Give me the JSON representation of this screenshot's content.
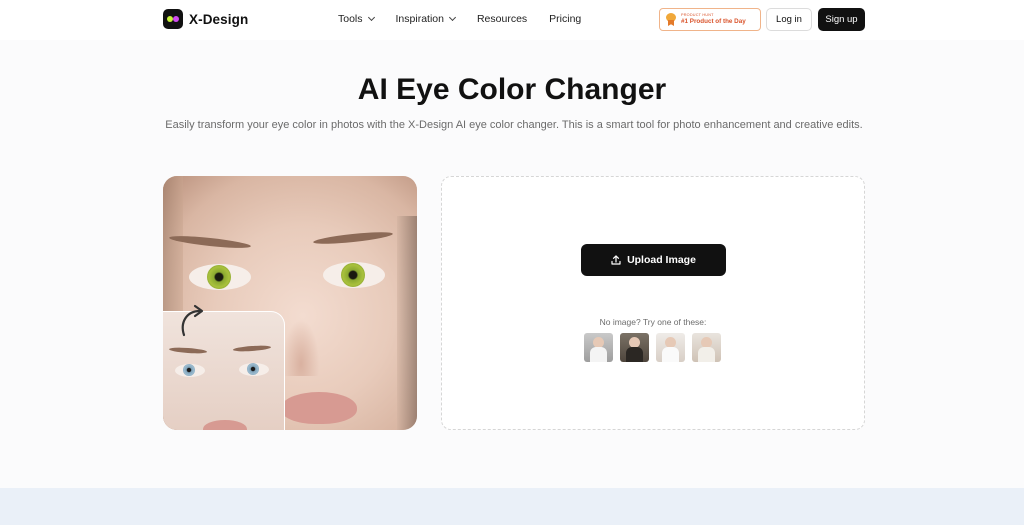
{
  "header": {
    "logo_text": "X-Design",
    "nav": [
      {
        "label": "Tools",
        "has_dropdown": true
      },
      {
        "label": "Inspiration",
        "has_dropdown": true
      },
      {
        "label": "Resources",
        "has_dropdown": false
      },
      {
        "label": "Pricing",
        "has_dropdown": false
      }
    ],
    "badge": {
      "small_text": "PRODUCT HUNT",
      "main_text": "#1 Product of the Day"
    },
    "login_label": "Log in",
    "signup_label": "Sign up"
  },
  "hero": {
    "title": "AI Eye Color Changer",
    "subtitle": "Easily transform your eye color in photos with the X-Design AI eye color changer. This is a smart tool for photo enhancement and creative edits."
  },
  "upload": {
    "button_label": "Upload Image",
    "try_label": "No image? Try one of these:",
    "samples": [
      "sample-1",
      "sample-2",
      "sample-3",
      "sample-4"
    ]
  },
  "colors": {
    "accent": "#111111",
    "badge": "#d9532b",
    "bottom_band": "#eaf0f8"
  }
}
